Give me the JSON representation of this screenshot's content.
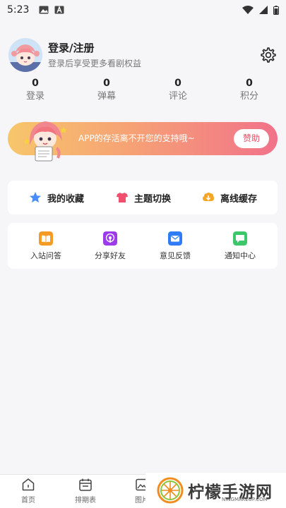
{
  "status_bar": {
    "time": "5:23"
  },
  "profile": {
    "title": "登录/注册",
    "subtitle": "登录后享受更多看剧权益"
  },
  "stats": [
    {
      "value": "0",
      "label": "登录"
    },
    {
      "value": "0",
      "label": "弹幕"
    },
    {
      "value": "0",
      "label": "评论"
    },
    {
      "value": "0",
      "label": "积分"
    }
  ],
  "banner": {
    "text": "APP的存活离不开您的支持哦~",
    "button": "赞助"
  },
  "actions": [
    {
      "label": "我的收藏",
      "icon": "star-icon",
      "color": "#4a8df8"
    },
    {
      "label": "主题切换",
      "icon": "tshirt-icon",
      "color": "#f0506e"
    },
    {
      "label": "离线缓存",
      "icon": "download-icon",
      "color": "#f5a623"
    }
  ],
  "tools": [
    {
      "label": "入站问答",
      "icon": "book-icon",
      "color": "#f59a23"
    },
    {
      "label": "分享好友",
      "icon": "podcast-icon",
      "color": "#9b3ce8"
    },
    {
      "label": "意见反馈",
      "icon": "mail-icon",
      "color": "#2f7cf6"
    },
    {
      "label": "通知中心",
      "icon": "chat-icon",
      "color": "#3cc86a"
    }
  ],
  "bottom_nav": [
    {
      "label": "首页",
      "icon": "home-icon"
    },
    {
      "label": "排期表",
      "icon": "calendar-icon"
    },
    {
      "label": "图片",
      "icon": "image-icon"
    }
  ],
  "watermark": {
    "text": "柠檬手游网",
    "sub": "NINGMAKEUP.COM"
  }
}
